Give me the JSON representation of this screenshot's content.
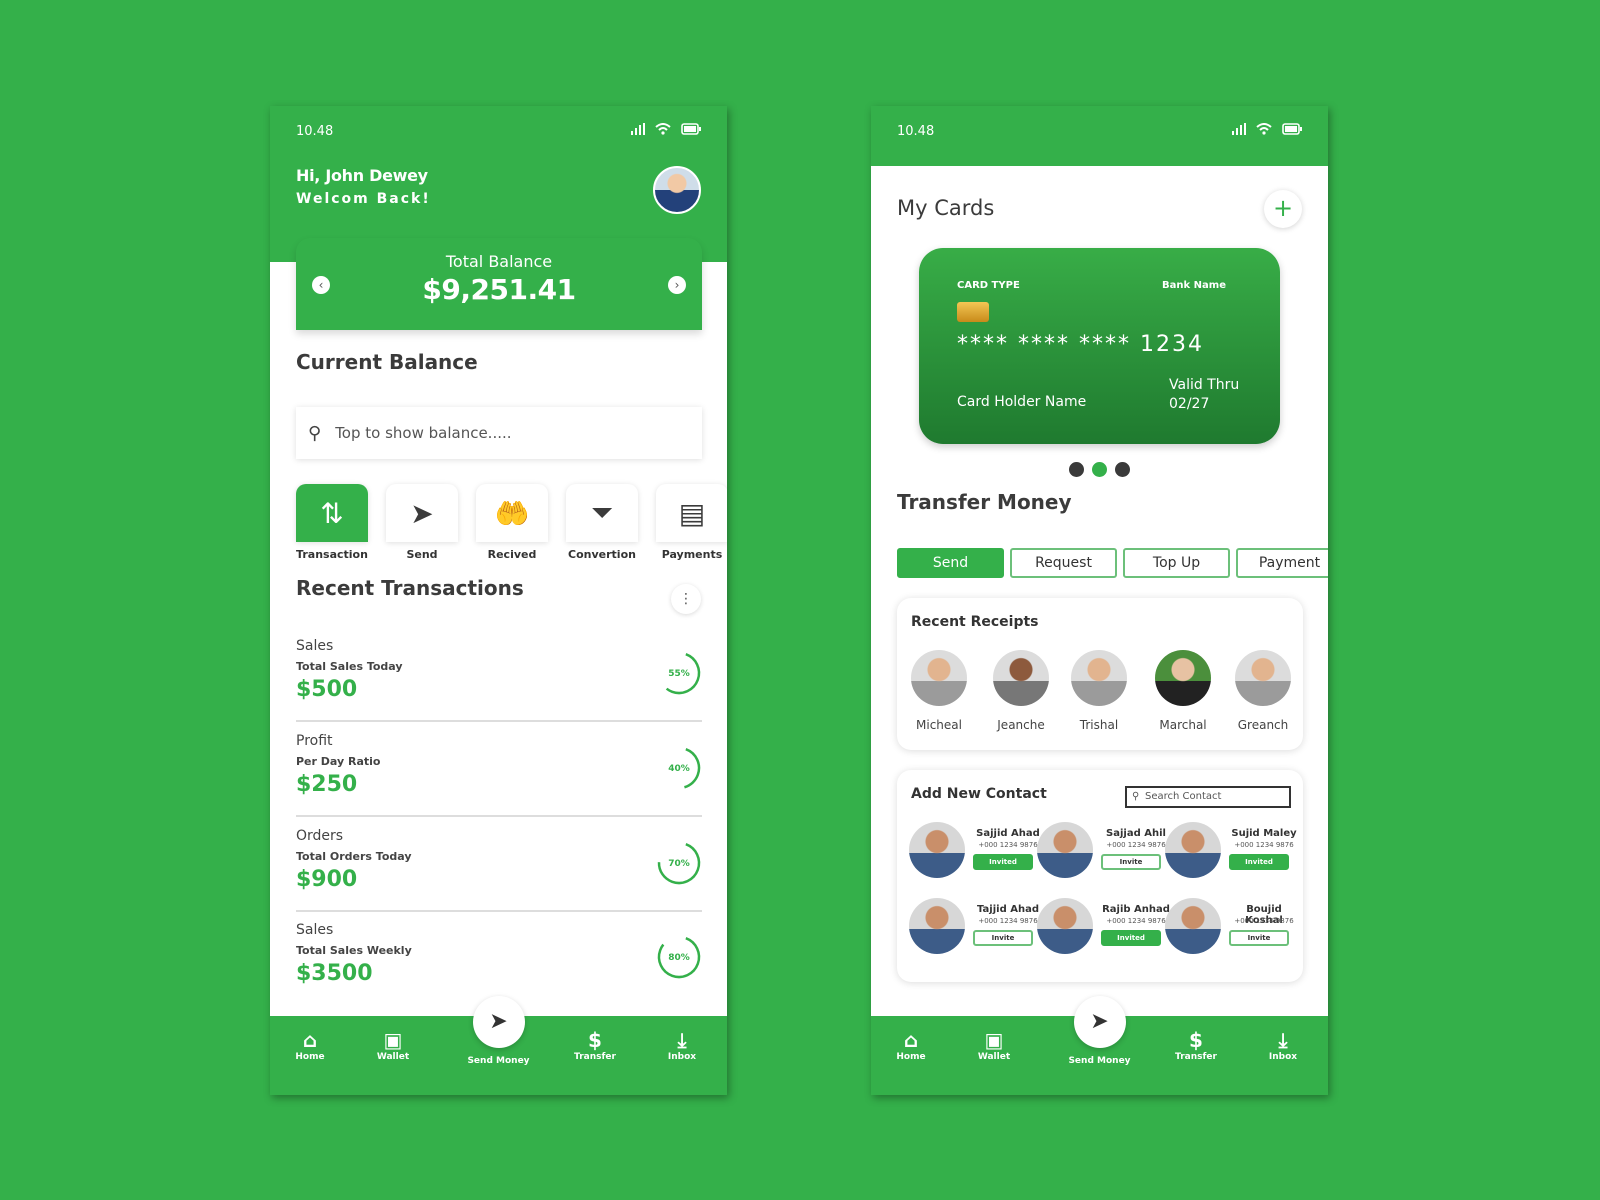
{
  "colors": {
    "brand_green": "#34b04a",
    "text_dark": "#3b3b3b"
  },
  "left": {
    "status": {
      "time": "10.48",
      "icons": [
        "signal-icon",
        "wifi-icon",
        "battery-icon"
      ]
    },
    "greeting": {
      "name": "Hi, John Dewey",
      "subtitle": "Welcom Back!"
    },
    "balance": {
      "label": "Total Balance",
      "amount": "$9,251.41",
      "prev": "‹",
      "next": "›"
    },
    "current_balance_title": "Current Balance",
    "search": {
      "placeholder": "Top to show balance....."
    },
    "quick_actions": [
      {
        "label": "Transaction",
        "icon": "⇅",
        "active": true
      },
      {
        "label": "Send",
        "icon": "➤"
      },
      {
        "label": "Recived",
        "icon": "🤲"
      },
      {
        "label": "Convertion",
        "icon": "⏷"
      },
      {
        "label": "Payments",
        "icon": "▤"
      }
    ],
    "recent_title": "Recent Transactions",
    "more_icon": "⋮",
    "transactions": [
      {
        "title": "Sales",
        "subtitle": "Total Sales Today",
        "amount": "$500",
        "percent": 55,
        "percent_label": "55%"
      },
      {
        "title": "Profit",
        "subtitle": "Per Day Ratio",
        "amount": "$250",
        "percent": 40,
        "percent_label": "40%"
      },
      {
        "title": "Orders",
        "subtitle": "Total Orders Today",
        "amount": "$900",
        "percent": 70,
        "percent_label": "70%"
      },
      {
        "title": "Sales",
        "subtitle": "Total Sales Weekly",
        "amount": "$3500",
        "percent": 80,
        "percent_label": "80%"
      }
    ]
  },
  "nav": [
    {
      "label": "Home",
      "icon": "⌂"
    },
    {
      "label": "Wallet",
      "icon": "▣"
    },
    {
      "label": "Send Money",
      "icon": "➤"
    },
    {
      "label": "Transfer",
      "icon": "$"
    },
    {
      "label": "Inbox",
      "icon": "⤓"
    }
  ],
  "right": {
    "status": {
      "time": "10.48"
    },
    "title": "My Cards",
    "add_icon": "+",
    "card": {
      "type": "CARD TYPE",
      "bank": "Bank Name",
      "number": "**** **** **** 1234",
      "holder": "Card Holder Name",
      "valid_label": "Valid Thru",
      "valid": "02/27"
    },
    "pager": {
      "count": 3,
      "active": 1
    },
    "transfer_title": "Transfer Money",
    "tabs": [
      {
        "label": "Send",
        "active": true
      },
      {
        "label": "Request"
      },
      {
        "label": "Top Up"
      },
      {
        "label": "Payment"
      }
    ],
    "receipts_title": "Recent Receipts",
    "receipts": [
      "Micheal",
      "Jeanche",
      "Trishal",
      "Marchal",
      "Greanch"
    ],
    "contacts_title": "Add New Contact",
    "contact_search_placeholder": "Search Contact",
    "contacts": [
      {
        "name": "Sajjid Ahad",
        "phone": "+000 1234 9876",
        "status": "Invited"
      },
      {
        "name": "Sajjad Ahil",
        "phone": "+000 1234 9876",
        "status": "Invite"
      },
      {
        "name": "Sujid Maley",
        "phone": "+000 1234 9876",
        "status": "Invited"
      },
      {
        "name": "Tajjid Ahad",
        "phone": "+000 1234 9876",
        "status": "Invite"
      },
      {
        "name": "Rajib Anhad",
        "phone": "+000 1234 9876",
        "status": "Invited"
      },
      {
        "name": "Boujid Koshal",
        "phone": "+000 1234 9876",
        "status": "Invite"
      }
    ]
  }
}
